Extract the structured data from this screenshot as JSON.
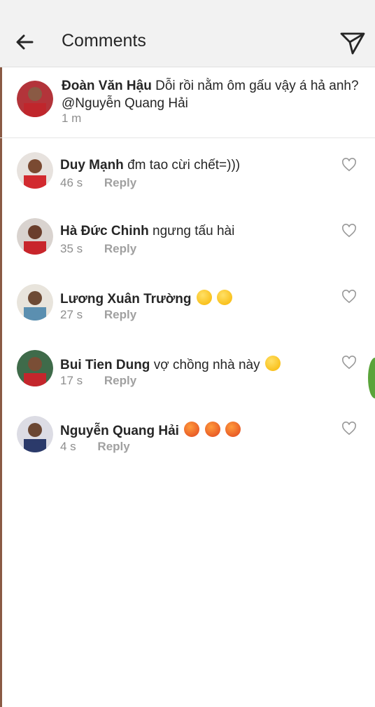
{
  "header": {
    "title": "Comments"
  },
  "caption": {
    "user": "Đoàn Văn Hậu",
    "text": "Dỗi rồi nằm ôm gấu vậy á hả anh?",
    "mention": "@Nguyễn Quang Hải",
    "time": "1 m"
  },
  "comments": [
    {
      "user": "Duy Mạnh",
      "text": "đm tao cừi chết=)))",
      "time": "46 s",
      "reply": "Reply",
      "emoji": []
    },
    {
      "user": "Hà Đức Chinh",
      "text": "ngưng tấu hài",
      "time": "35 s",
      "reply": "Reply",
      "emoji": []
    },
    {
      "user": "Lương Xuân Trường",
      "text": "",
      "time": "27 s",
      "reply": "Reply",
      "emoji": [
        "rolling-laughing",
        "rolling-laughing"
      ]
    },
    {
      "user": "Bui Tien Dung",
      "text": "vợ chồng nhà này",
      "time": "17 s",
      "reply": "Reply",
      "emoji": [
        "rolling-laughing"
      ]
    },
    {
      "user": "Nguyễn Quang Hải",
      "text": "",
      "time": "4 s",
      "reply": "Reply",
      "emoji": [
        "angry-face",
        "angry-face",
        "angry-face"
      ]
    }
  ],
  "colors": {
    "text": "#262626",
    "secondary": "#8e8e8e",
    "header_bg": "#f2f2f2",
    "emoji_laugh": "#f7b500",
    "emoji_angry": "#e0451f"
  }
}
